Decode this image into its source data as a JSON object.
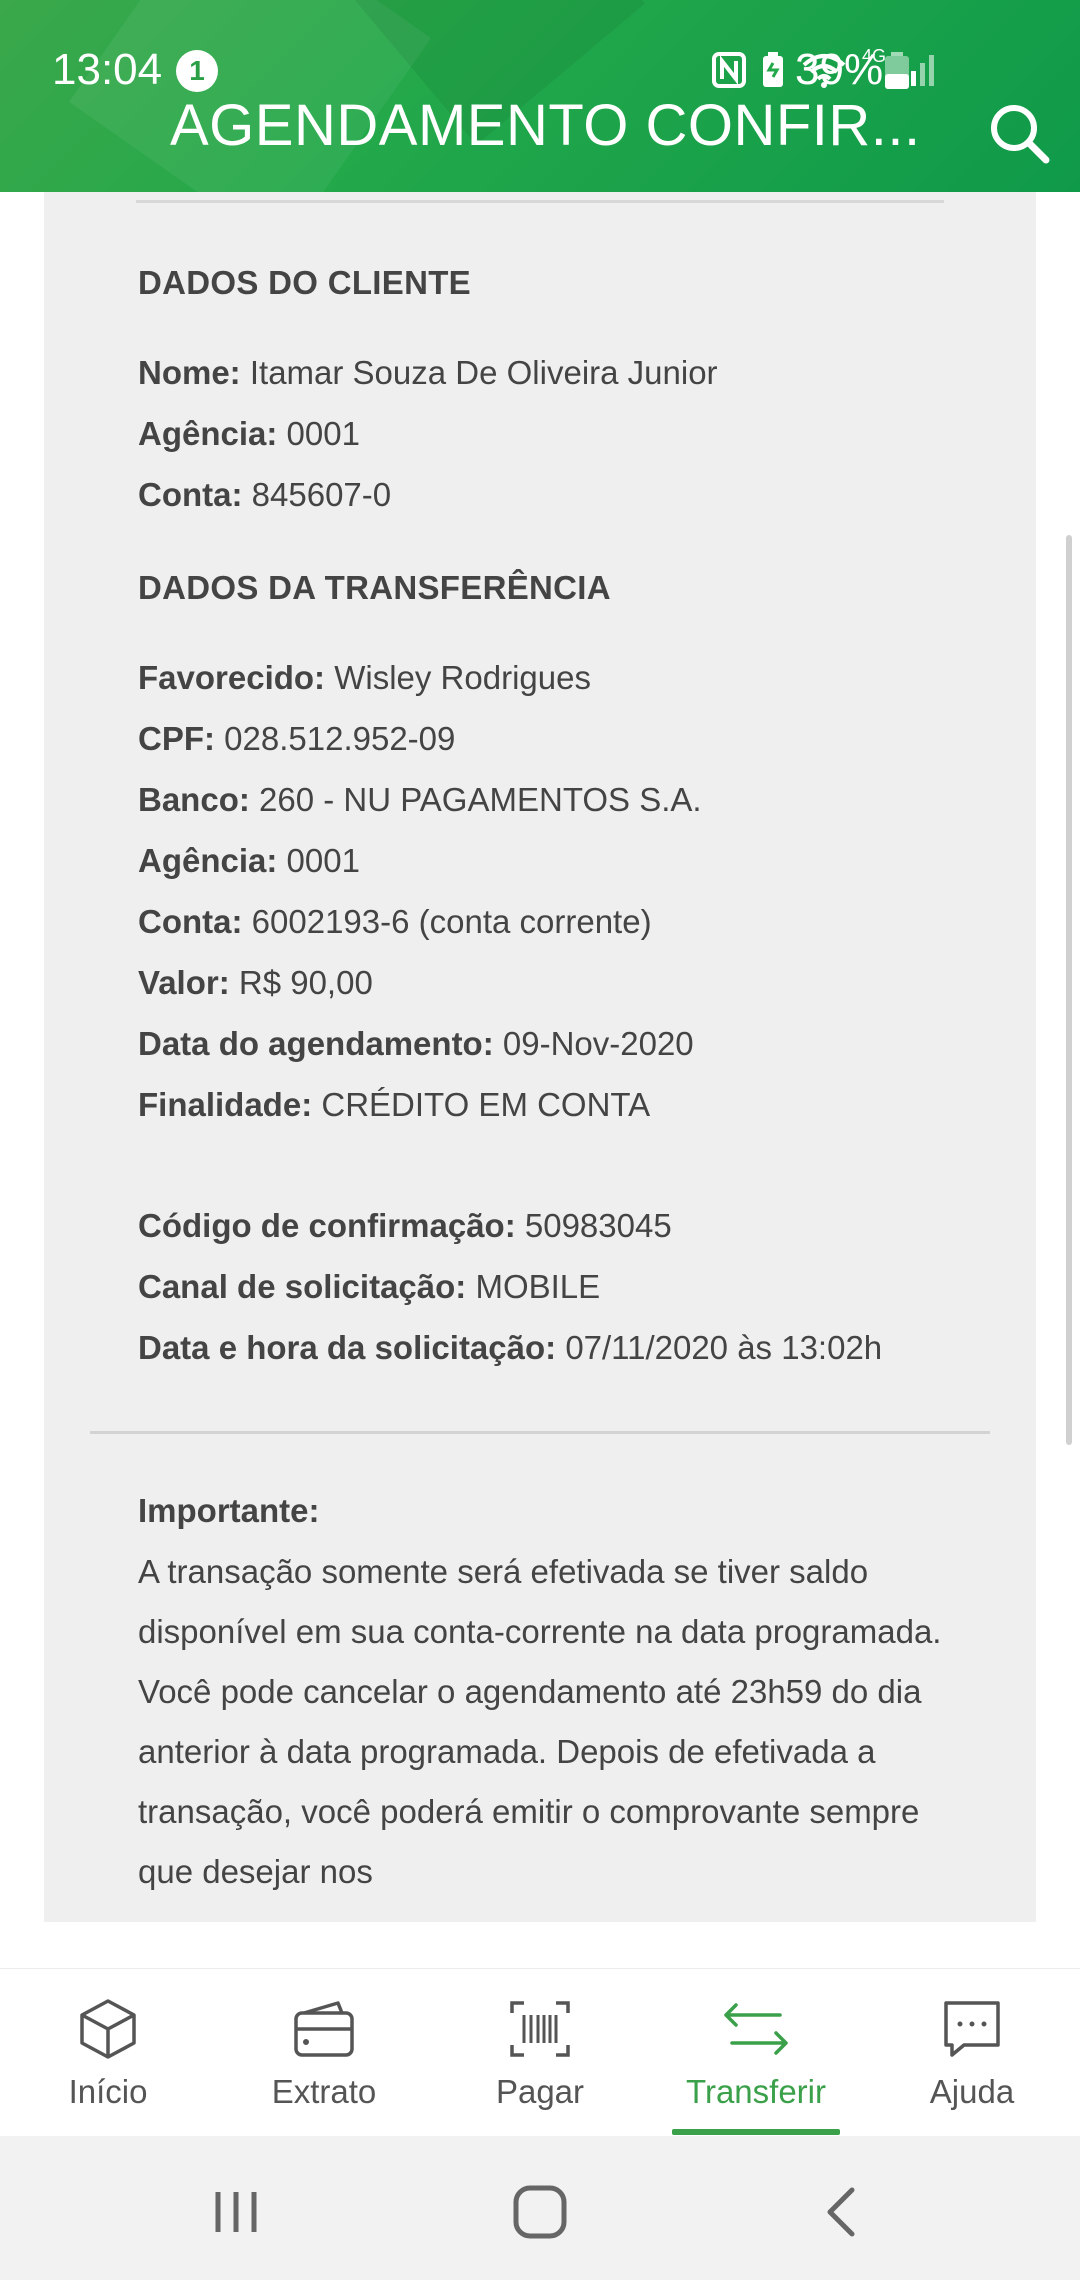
{
  "status_bar": {
    "time": "13:04",
    "notification_count": "1",
    "network": "4G",
    "battery": "39%"
  },
  "header": {
    "title": "AGENDAMENTO CONFIR...",
    "search_icon": "search-icon"
  },
  "cliente": {
    "section_title": "DADOS DO CLIENTE",
    "rows": [
      {
        "label": "Nome:",
        "value": "Itamar Souza De Oliveira Junior"
      },
      {
        "label": "Agência:",
        "value": "0001"
      },
      {
        "label": "Conta:",
        "value": "845607-0"
      }
    ]
  },
  "transferencia": {
    "section_title": "DADOS DA TRANSFERÊNCIA",
    "rows": [
      {
        "label": "Favorecido:",
        "value": "Wisley Rodrigues"
      },
      {
        "label": "CPF:",
        "value": "028.512.952-09"
      },
      {
        "label": "Banco:",
        "value": "260 - NU PAGAMENTOS S.A."
      },
      {
        "label": "Agência:",
        "value": "0001"
      },
      {
        "label": "Conta:",
        "value": "6002193-6 (conta corrente)"
      },
      {
        "label": "Valor:",
        "value": "R$ 90,00"
      },
      {
        "label": "Data do agendamento:",
        "value": "09-Nov-2020"
      },
      {
        "label": "Finalidade:",
        "value": "CRÉDITO EM CONTA"
      }
    ]
  },
  "solicitacao": {
    "rows": [
      {
        "label": "Código de confirmação:",
        "value": "50983045"
      },
      {
        "label": "Canal de solicitação:",
        "value": "MOBILE"
      },
      {
        "label": "Data e hora da solicitação:",
        "value": "07/11/2020 às 13:02h"
      }
    ]
  },
  "importante": {
    "title": "Importante:",
    "text": "A transação somente será efetivada se tiver saldo disponível em sua conta-corrente na data programada. Você pode cancelar o agendamento até 23h59 do dia anterior à data programada. Depois de efetivada a transação, você poderá emitir o comprovante sempre que desejar nos"
  },
  "bottom_nav": {
    "items": [
      {
        "label": "Início",
        "icon": "cube-icon"
      },
      {
        "label": "Extrato",
        "icon": "wallet-icon"
      },
      {
        "label": "Pagar",
        "icon": "barcode-icon"
      },
      {
        "label": "Transferir",
        "icon": "transfer-arrows-icon",
        "active": true
      },
      {
        "label": "Ajuda",
        "icon": "chat-icon"
      }
    ],
    "active_color": "#3aa04a"
  },
  "colors": {
    "header_green": "#23a84a",
    "content_bg": "#efefef",
    "text": "#444444"
  }
}
